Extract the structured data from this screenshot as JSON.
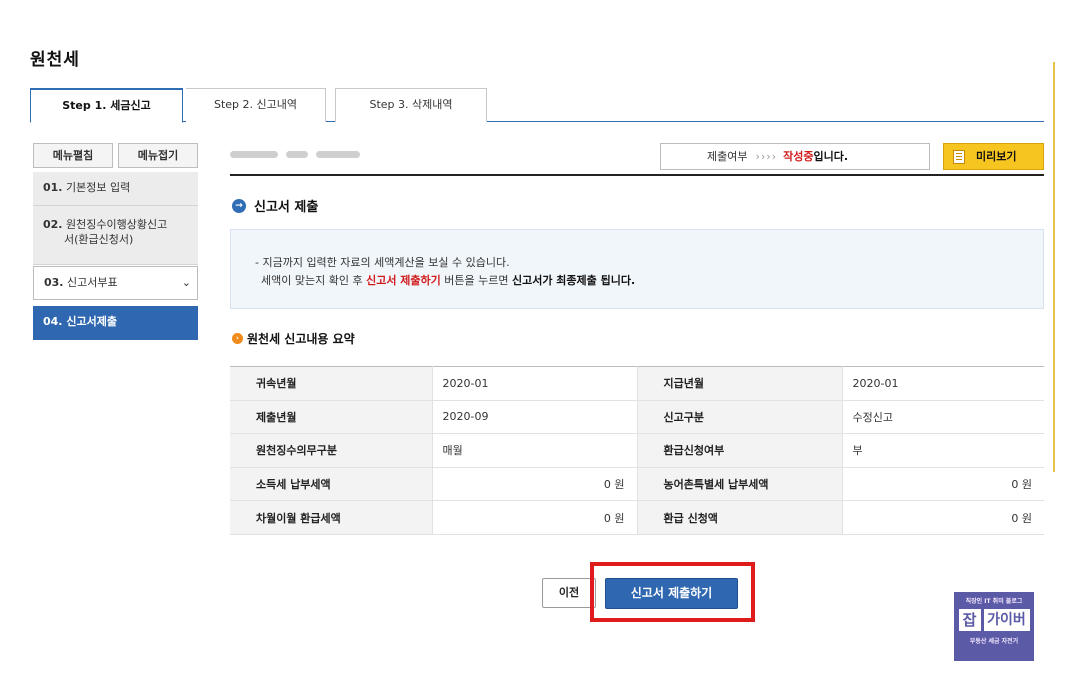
{
  "page": {
    "title": "원천세"
  },
  "tabs": [
    {
      "label": "Step 1. 세금신고",
      "active": true
    },
    {
      "label": "Step 2. 신고내역",
      "active": false
    },
    {
      "label": "Step 3. 삭제내역",
      "active": false
    }
  ],
  "sidebar": {
    "expand_label": "메뉴펼침",
    "collapse_label": "메뉴접기",
    "items": [
      {
        "num": "01.",
        "label": "기본정보 입력"
      },
      {
        "num": "02.",
        "label": "원천징수이행상황신고",
        "label2": "서(환급신청서)"
      },
      {
        "num": "03.",
        "label": "신고서부표",
        "caret": "⌄"
      },
      {
        "num": "04.",
        "label": "신고서제출",
        "active": true
      }
    ]
  },
  "status_bar": {
    "label": "제출여부",
    "arrows": "››››",
    "status": "작성중",
    "suffix": "입니다.",
    "preview_label": "미리보기"
  },
  "section": {
    "icon": "→",
    "title": "신고서 제출"
  },
  "info": {
    "line1": "- 지금까지 입력한 자료의 세액계산을 보실 수 있습니다.",
    "line2_a": "세액이 맞는지 확인 후 ",
    "line2_red": "신고서 제출하기",
    "line2_b": " 버튼을 누르면 ",
    "line2_bold": "신고서가 최종제출 됩니다."
  },
  "summary": {
    "icon": "›",
    "title": "원천세 신고내용 요약",
    "rows": [
      {
        "k1": "귀속년월",
        "v1": "2020-01",
        "k2": "지급년월",
        "v2": "2020-01"
      },
      {
        "k1": "제출년월",
        "v1": "2020-09",
        "k2": "신고구분",
        "v2": "수정신고"
      },
      {
        "k1": "원천징수의무구분",
        "v1": "매월",
        "k2": "환급신청여부",
        "v2": "부"
      },
      {
        "k1": "소득세 납부세액",
        "v1": "0 원",
        "k2": "농어촌특별세 납부세액",
        "v2": "0 원"
      },
      {
        "k1": "차월이월 환급세액",
        "v1": "0 원",
        "k2": "환급 신청액",
        "v2": "0 원"
      }
    ]
  },
  "actions": {
    "prev_label": "이전",
    "submit_label": "신고서 제출하기"
  },
  "watermark": {
    "top": "직장인 IT 취미 블로그",
    "brand_a": "잡",
    "brand_b": "가이버",
    "bottom": "부동산 세금 자전거"
  },
  "colors": {
    "primary": "#2f68b0",
    "alert_red": "#d11b1b",
    "preview_yellow": "#f7c520",
    "watermark_purple": "#5b5aa6"
  }
}
